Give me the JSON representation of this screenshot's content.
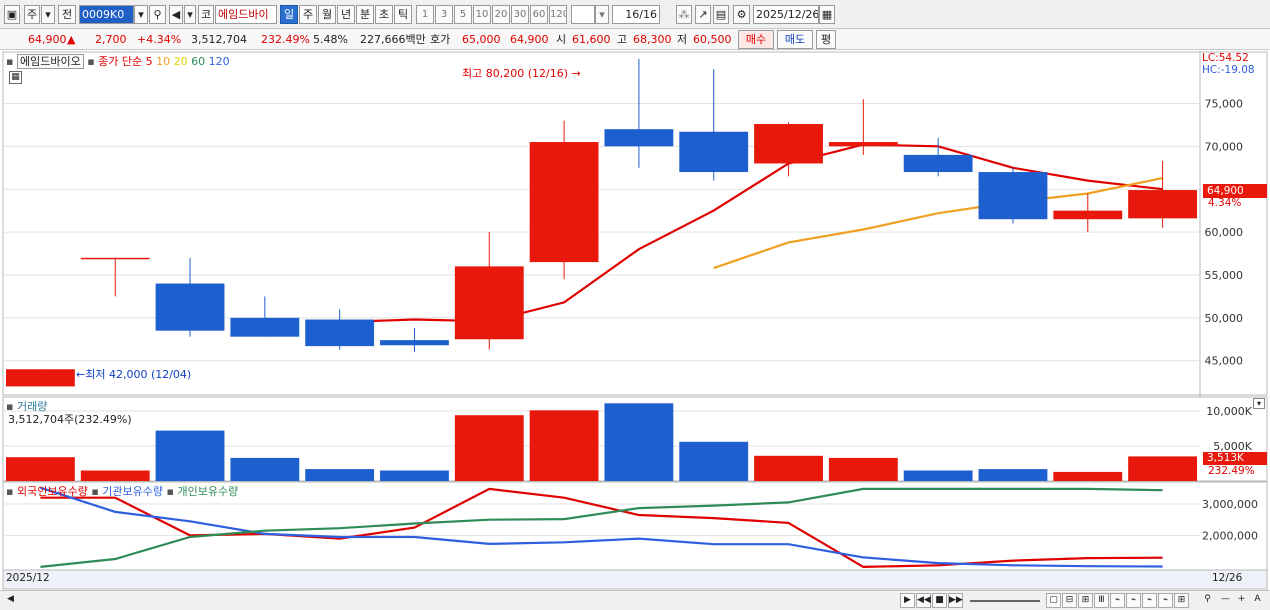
{
  "toolbar": {
    "period_prefix": "주",
    "prev_label": "전",
    "code": "0009K0",
    "name_prefix": "코",
    "stock_name": "에임드바이",
    "periods": [
      "일",
      "주",
      "월",
      "년",
      "분",
      "초",
      "틱"
    ],
    "active_period": "일",
    "intervals": [
      "1",
      "3",
      "5",
      "10",
      "20",
      "30",
      "60",
      "120"
    ],
    "count": "16",
    "count_total": "/16",
    "date": "2025/12/26"
  },
  "quote": {
    "price": "64,900",
    "change": "2,700",
    "change_pct": "+4.34%",
    "volume": "3,512,704",
    "volume_ratio": "232.49%",
    "turnover": "5.48%",
    "amount": "227,666백만",
    "bid_label": "호가",
    "bid": "65,000",
    "ask": "64,900",
    "open_label": "시",
    "open": "61,600",
    "high_label": "고",
    "high": "68,300",
    "low_label": "저",
    "low": "60,500",
    "buy_label": "매수",
    "sell_label": "매도",
    "avg_label": "평"
  },
  "price_pane": {
    "stock_label": "에임드바이오",
    "ma_label": "종가 단순",
    "ma_periods": [
      "5",
      "10",
      "20",
      "60",
      "120"
    ],
    "lc": "LC:54.52",
    "hc": "HC:-19.08",
    "high_note": "최고 80,200 (12/16)",
    "low_note": "최저 42,000 (12/04)",
    "last_price": "64,900",
    "last_pct": "4.34%",
    "y_ticks": [
      "75,000",
      "70,000",
      "65,000",
      "60,000",
      "55,000",
      "50,000",
      "45,000"
    ]
  },
  "volume_pane": {
    "label": "거래량",
    "value": "3,512,704주(232.49%)",
    "y_ticks": [
      "10,000K",
      "5,000K"
    ],
    "last_value": "3,513K",
    "last_pct": "232.49%"
  },
  "holder_pane": {
    "series_labels": [
      "외국인보유수량",
      "기관보유수량",
      "개인보유수량"
    ],
    "y_ticks": [
      "3,000,000",
      "2,000,000"
    ]
  },
  "axis": {
    "left_date": "2025/12",
    "right_date": "12/26"
  },
  "colors": {
    "up": "#e8190c",
    "down": "#1e5fcf",
    "ma5": "#e00000",
    "ma10": "#f0a020",
    "foreign": "#e00000",
    "institution": "#2f5fe0",
    "individual": "#2e8b57"
  },
  "chart_data": [
    {
      "type": "candlestick",
      "series": [
        {
          "name": "에임드바이오",
          "ohlc": [
            [
              42000,
              44000,
              42000,
              44000
            ],
            [
              57000,
              57000,
              52500,
              57000
            ],
            [
              54000,
              57000,
              47800,
              48500
            ],
            [
              50000,
              52500,
              47800,
              47800
            ],
            [
              49800,
              51000,
              46300,
              46700
            ],
            [
              47400,
              48800,
              46000,
              46800
            ],
            [
              47500,
              60000,
              46300,
              56000
            ],
            [
              56500,
              73000,
              54500,
              70500
            ],
            [
              72000,
              80200,
              67500,
              70000
            ],
            [
              71700,
              79000,
              66000,
              67000
            ],
            [
              68000,
              72800,
              66500,
              72600
            ],
            [
              70000,
              75500,
              69000,
              70500
            ],
            [
              69000,
              71000,
              66500,
              67000
            ],
            [
              67000,
              67500,
              61000,
              61500
            ],
            [
              61500,
              64500,
              60000,
              62500
            ],
            [
              61600,
              68300,
              60500,
              64900
            ]
          ]
        },
        {
          "name": "5",
          "values": [
            null,
            null,
            null,
            null,
            49500,
            49800,
            49600,
            51800,
            58000,
            62500,
            68000,
            70200,
            70000,
            67500,
            66000,
            65000
          ]
        },
        {
          "name": "10",
          "values": [
            null,
            null,
            null,
            null,
            null,
            null,
            null,
            null,
            null,
            55800,
            58800,
            60300,
            62200,
            63500,
            64500,
            66300
          ]
        }
      ],
      "ylim": [
        41000,
        81000
      ]
    },
    {
      "type": "bar",
      "series": [
        {
          "name": "거래량",
          "values": [
            3400,
            1500,
            7200,
            3300,
            1700,
            1500,
            9400,
            10100,
            11100,
            5600,
            3600,
            3300,
            1500,
            1700,
            1300,
            3513
          ]
        }
      ],
      "y_ticks": [
        "10,000K",
        "5,000K"
      ],
      "ylim": [
        0,
        12000
      ]
    },
    {
      "type": "line",
      "series": [
        {
          "name": "외국인보유수량",
          "values": [
            3200000,
            3200000,
            2000000,
            2050000,
            1900000,
            2250000,
            3480000,
            3200000,
            2650000,
            2550000,
            2400000,
            1000000,
            1050000,
            1200000,
            1280000,
            1290000
          ]
        },
        {
          "name": "기관보유수량",
          "values": [
            3520000,
            2750000,
            2450000,
            2050000,
            1950000,
            1950000,
            1730000,
            1780000,
            1900000,
            1720000,
            1720000,
            1300000,
            1120000,
            1050000,
            1020000,
            1010000
          ]
        },
        {
          "name": "개인보유수량",
          "values": [
            1000000,
            1250000,
            1950000,
            2150000,
            2230000,
            2380000,
            2500000,
            2520000,
            2870000,
            2950000,
            3050000,
            3480000,
            3480000,
            3480000,
            3480000,
            3440000
          ]
        }
      ],
      "y_ticks": [
        "3,000,000",
        "2,000,000"
      ],
      "ylim": [
        900000,
        3700000
      ]
    }
  ]
}
